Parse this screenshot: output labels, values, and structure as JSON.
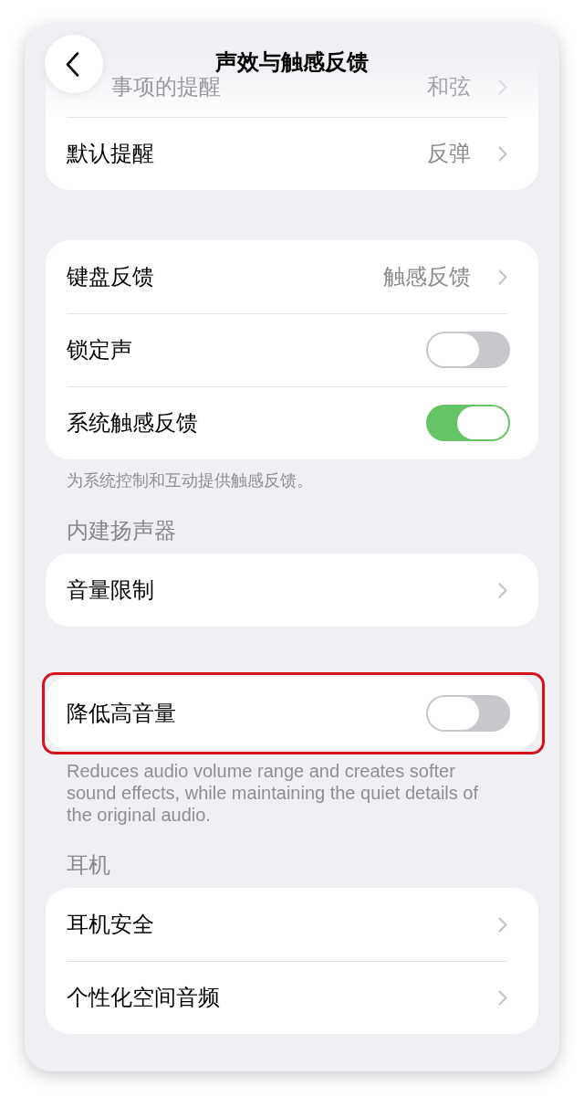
{
  "nav": {
    "title": "声效与触感反馈"
  },
  "sections": [
    {
      "highlighted": false,
      "rows": [
        {
          "kind": "link",
          "label": "事项的提醒",
          "value": "和弦",
          "obscured": true
        },
        {
          "kind": "link",
          "label": "默认提醒",
          "value": "反弹",
          "obscured": false
        }
      ]
    },
    {
      "highlighted": false,
      "rows": [
        {
          "kind": "link",
          "label": "键盘反馈",
          "value": "触感反馈",
          "obscured": false
        },
        {
          "kind": "toggle",
          "label": "锁定声",
          "on": false,
          "obscured": false
        },
        {
          "kind": "toggle",
          "label": "系统触感反馈",
          "on": true,
          "obscured": false
        }
      ],
      "footer": "为系统控制和互动提供触感反馈。"
    },
    {
      "header": "内建扬声器",
      "highlighted": false,
      "rows": [
        {
          "kind": "link",
          "label": "音量限制",
          "obscured": false
        }
      ]
    },
    {
      "highlighted": true,
      "rows": [
        {
          "kind": "toggle",
          "label": "降低高音量",
          "on": false,
          "obscured": false
        }
      ],
      "footer": "Reduces audio volume range and creates softer sound effects, while maintaining the quiet details of the original audio."
    },
    {
      "header": "耳机",
      "highlighted": false,
      "rows": [
        {
          "kind": "link",
          "label": "耳机安全",
          "obscured": false
        },
        {
          "kind": "link",
          "label": "个性化空间音频",
          "obscured": false
        }
      ]
    }
  ]
}
